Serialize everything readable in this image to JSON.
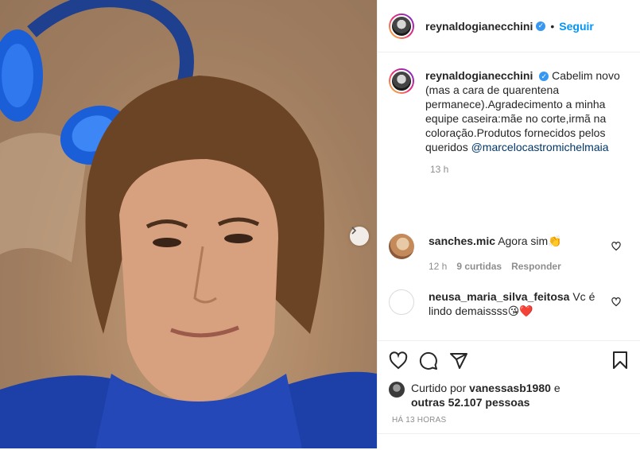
{
  "post": {
    "username": "reynaldogianecchini",
    "follow_label": "Seguir",
    "separator": "•",
    "verified_glyph": "✓",
    "caption_text": "Cabelim novo (mas a cara de quarentena permanece).Agradecimento a minha equipe caseira:mãe no corte,irmã na coloração.Produtos fornecidos pelos queridos ",
    "caption_mention": "@marcelocastromichelmaia",
    "caption_time": "13 h"
  },
  "comments": [
    {
      "username": "sanches.mic",
      "text": "Agora sim",
      "emoji": "👏",
      "time": "12 h",
      "likes": "9 curtidas",
      "reply_label": "Responder"
    },
    {
      "username": "neusa_maria_silva_feitosa",
      "text": "Vc é lindo demaissss",
      "emoji": "😘❤️"
    }
  ],
  "likes": {
    "prefix": "Curtido por",
    "user": "vanessasb1980",
    "and": "e",
    "others": "outras 52.107 pessoas"
  },
  "timestamp": "HÁ 13 HORAS",
  "icons": {
    "like": "heart-icon",
    "comment": "comment-icon",
    "share": "share-icon",
    "save": "bookmark-icon",
    "next": "chevron-right-icon"
  },
  "colors": {
    "accent": "#0095f6",
    "verified": "#3897f0",
    "text": "#262626",
    "muted": "#8e8e8e"
  }
}
